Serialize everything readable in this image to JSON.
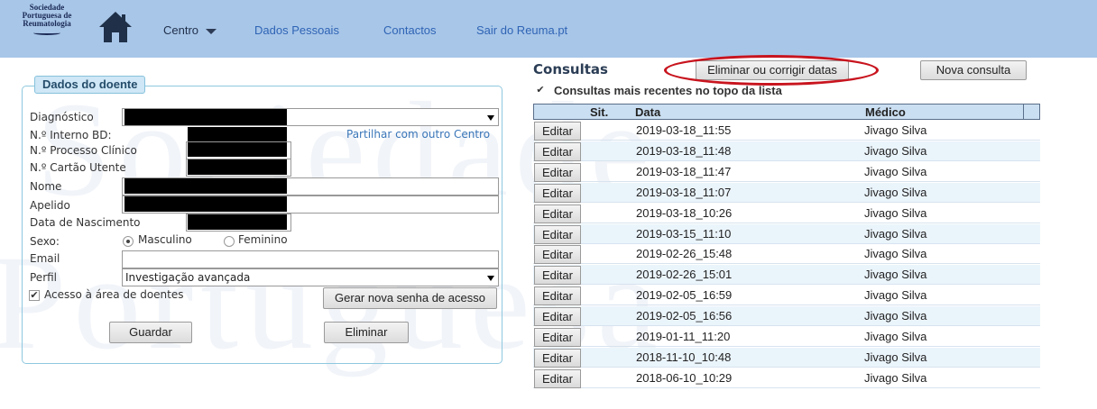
{
  "header": {
    "logo_lines": [
      "Sociedade",
      "Portuguesa de",
      "Reumatologia"
    ],
    "nav": {
      "centro": "Centro",
      "dados_pessoais": "Dados Pessoais",
      "contactos": "Contactos",
      "sair": "Sair do Reuma.pt"
    },
    "bar_color": "#a8c6e8"
  },
  "patient": {
    "legend": "Dados do doente",
    "labels": {
      "diagnostico": "Diagnóstico",
      "interno": "N.º Interno BD:",
      "processo": "N.º Processo Clínico",
      "cartao": "N.º Cartão Utente",
      "nome": "Nome",
      "apelido": "Apelido",
      "nascimento": "Data de Nascimento",
      "sexo": "Sexo:",
      "email": "Email",
      "perfil": "Perfil"
    },
    "share_link": "Partilhar com outro Centro",
    "sex_options": [
      "Masculino",
      "Feminino"
    ],
    "sex_selected": "Masculino",
    "perfil_value": "Investigação avançada",
    "acesso_label": "Acesso à área de doentes",
    "acesso_checked": true,
    "gerar_button": "Gerar nova senha de acesso",
    "guardar_button": "Guardar",
    "eliminar_button": "Eliminar"
  },
  "consultas": {
    "title": "Consultas",
    "eliminar_corrigir_button": "Eliminar ou corrigir datas",
    "nova_button": "Nova consulta",
    "recent_top_label": "Consultas mais recentes no topo da lista",
    "recent_top_checked": true,
    "columns": [
      "Sit.",
      "Data",
      "Médico"
    ],
    "edit_label": "Editar",
    "rows": [
      {
        "date": "2019-03-18_11:55",
        "doctor": "Jivago Silva"
      },
      {
        "date": "2019-03-18_11:48",
        "doctor": "Jivago Silva"
      },
      {
        "date": "2019-03-18_11:47",
        "doctor": "Jivago Silva"
      },
      {
        "date": "2019-03-18_11:07",
        "doctor": "Jivago Silva"
      },
      {
        "date": "2019-03-18_10:26",
        "doctor": "Jivago Silva"
      },
      {
        "date": "2019-03-15_11:10",
        "doctor": "Jivago Silva"
      },
      {
        "date": "2019-02-26_15:48",
        "doctor": "Jivago Silva"
      },
      {
        "date": "2019-02-26_15:01",
        "doctor": "Jivago Silva"
      },
      {
        "date": "2019-02-05_16:59",
        "doctor": "Jivago Silva"
      },
      {
        "date": "2019-02-05_16:56",
        "doctor": "Jivago Silva"
      },
      {
        "date": "2019-01-11_11:20",
        "doctor": "Jivago Silva"
      },
      {
        "date": "2018-11-10_10:48",
        "doctor": "Jivago Silva"
      },
      {
        "date": "2018-06-10_10:29",
        "doctor": "Jivago Silva"
      }
    ],
    "highlight_color": "#c8141e"
  }
}
